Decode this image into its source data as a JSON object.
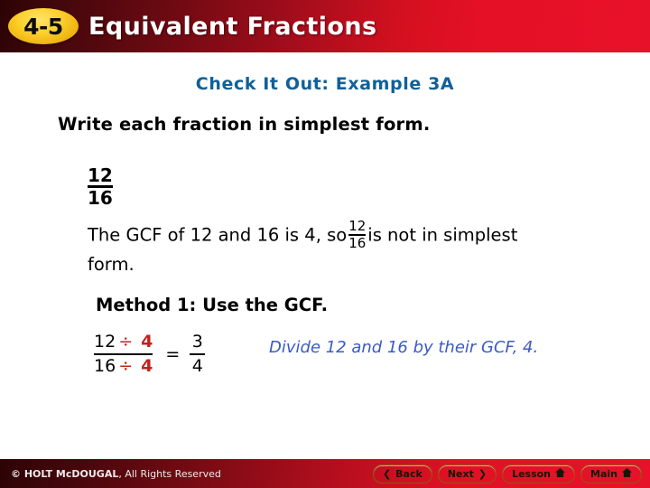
{
  "header": {
    "lesson_number": "4-5",
    "title": "Equivalent Fractions",
    "gradient_left": "#2d0306",
    "gradient_right": "#e8112a",
    "badge_color": "#fcd12f"
  },
  "slide": {
    "example_title": "Check It Out: Example 3A",
    "example_title_color": "#10609a",
    "instruction": "Write each fraction in simplest form.",
    "problem_fraction": {
      "numerator": "12",
      "denominator": "16"
    },
    "gcf_sentence": {
      "part1": "The GCF of 12 and 16 is 4, so",
      "fraction_numerator": "12",
      "fraction_denominator": "16",
      "part2": "is not",
      "part3": "in simplest form."
    },
    "method_title": "Method 1: Use the GCF.",
    "equation": {
      "numerator_value": "12",
      "denominator_value": "16",
      "divide_symbol": "÷",
      "divisor": "4",
      "equals": "=",
      "result_numerator": "3",
      "result_denominator": "4",
      "accent_color": "#c0221f"
    },
    "note": "Divide 12 and 16 by their GCF, 4.",
    "note_color": "#3b5bc4"
  },
  "footer": {
    "copyright_brand": "© HOLT McDOUGAL",
    "copyright_rest": ", All Rights Reserved",
    "buttons": [
      {
        "label": "Back",
        "icon": "chevron-left-icon",
        "glyph": "❮"
      },
      {
        "label": "Next",
        "icon": "chevron-right-icon",
        "glyph": "❯"
      },
      {
        "label": "Lesson",
        "icon": "home-icon",
        "glyph": "⌂"
      },
      {
        "label": "Main",
        "icon": "home-icon",
        "glyph": "⌂"
      }
    ]
  }
}
